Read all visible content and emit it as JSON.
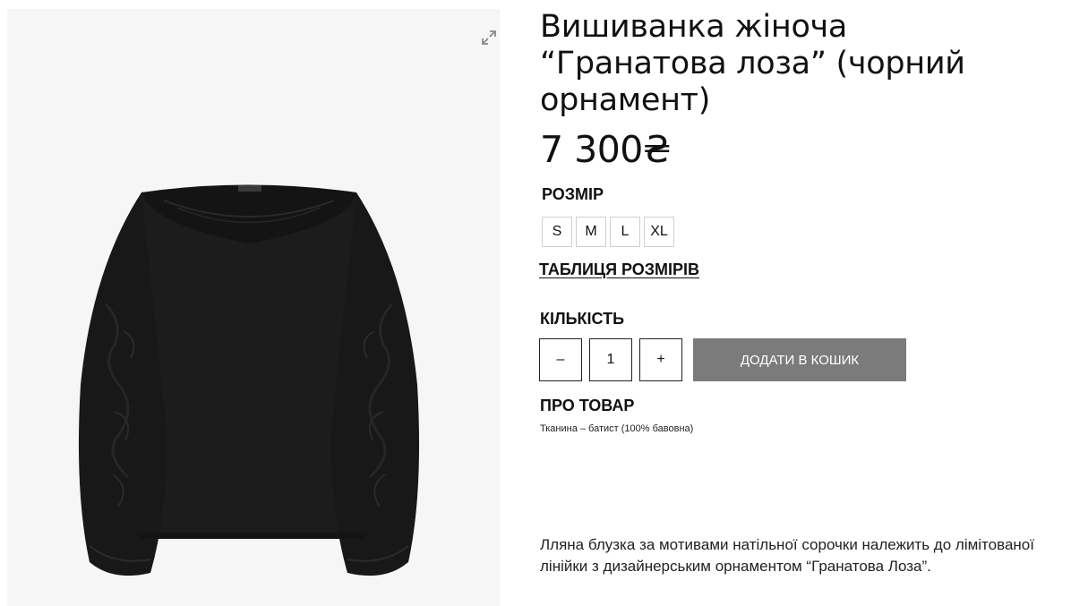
{
  "product": {
    "title": "Вишиванка жіноча “Гранатова лоза” (чорний орнамент)",
    "price": "7 300₴",
    "image": {
      "icon": "expand-icon"
    }
  },
  "size": {
    "label": "Розмір",
    "options": [
      "S",
      "M",
      "L",
      "XL"
    ],
    "chart_link": "ТАБЛИЦЯ РОЗМІРІВ"
  },
  "quantity": {
    "label": "Кількість",
    "minus": "–",
    "value": "1",
    "plus": "+"
  },
  "cart": {
    "add_label": "Додати в кошик"
  },
  "about": {
    "label": "Про товар",
    "fabric": "Тканина – батист (100% бавовна)",
    "description": "Лляна блузка за мотивами натільної сорочки належить до лімітованої лінійки з дизайнерським орнаментом “Гранатова Лоза”."
  },
  "colors": {
    "button_bg": "#7b7b7b",
    "text": "#111111",
    "image_bg": "#f6f6f6",
    "garment": "#1c1c1c"
  }
}
